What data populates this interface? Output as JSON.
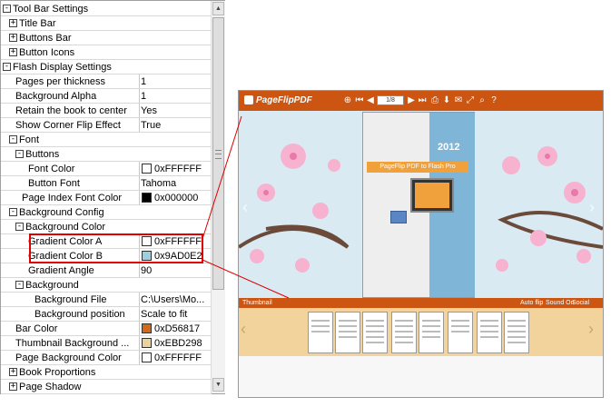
{
  "properties": [
    {
      "name": "Tool Bar Settings",
      "value": "",
      "indent": 0,
      "exp": "-",
      "cat": true
    },
    {
      "name": "Title Bar",
      "value": "",
      "indent": 1,
      "exp": "+",
      "cat": true
    },
    {
      "name": "Buttons Bar",
      "value": "",
      "indent": 1,
      "exp": "+",
      "cat": true
    },
    {
      "name": "Button Icons",
      "value": "",
      "indent": 1,
      "exp": "+",
      "cat": true
    },
    {
      "name": "Flash Display Settings",
      "value": "",
      "indent": 0,
      "exp": "-",
      "cat": true
    },
    {
      "name": "Pages per thickness",
      "value": "1",
      "indent": 2
    },
    {
      "name": "Background Alpha",
      "value": "1",
      "indent": 2
    },
    {
      "name": "Retain the book to center",
      "value": "Yes",
      "indent": 2
    },
    {
      "name": "Show Corner Flip Effect",
      "value": "True",
      "indent": 2
    },
    {
      "name": "Font",
      "value": "",
      "indent": 1,
      "exp": "-",
      "cat": true
    },
    {
      "name": "Buttons",
      "value": "",
      "indent": 2,
      "exp": "-",
      "cat": true
    },
    {
      "name": "Font Color",
      "value": "0xFFFFFF",
      "indent": 4,
      "swatch": "#ffffff"
    },
    {
      "name": "Button Font",
      "value": "Tahoma",
      "indent": 4
    },
    {
      "name": "Page Index Font Color",
      "value": "0x000000",
      "indent": 3,
      "swatch": "#000000"
    },
    {
      "name": "Background Config",
      "value": "",
      "indent": 1,
      "exp": "-",
      "cat": true
    },
    {
      "name": "Background Color",
      "value": "",
      "indent": 2,
      "exp": "-",
      "cat": true
    },
    {
      "name": "Gradient Color A",
      "value": "0xFFFFFF",
      "indent": 4,
      "swatch": "#ffffff"
    },
    {
      "name": "Gradient Color B",
      "value": "0x9AD0E2",
      "indent": 4,
      "swatch": "#9ad0e2"
    },
    {
      "name": "Gradient Angle",
      "value": "90",
      "indent": 4
    },
    {
      "name": "Background",
      "value": "",
      "indent": 2,
      "exp": "-",
      "cat": true
    },
    {
      "name": "Background File",
      "value": "C:\\Users\\Mo...",
      "indent": 5
    },
    {
      "name": "Background position",
      "value": "Scale to fit",
      "indent": 5
    },
    {
      "name": "Bar Color",
      "value": "0xD56817",
      "indent": 2,
      "swatch": "#d56817"
    },
    {
      "name": "Thumbnail Background ...",
      "value": "0xEBD298",
      "indent": 2,
      "swatch": "#ebd298"
    },
    {
      "name": "Page Background Color",
      "value": "0xFFFFFF",
      "indent": 2,
      "swatch": "#ffffff"
    },
    {
      "name": "Book Proportions",
      "value": "",
      "indent": 1,
      "exp": "+",
      "cat": true
    },
    {
      "name": "Page Shadow",
      "value": "",
      "indent": 1,
      "exp": "+",
      "cat": true
    }
  ],
  "preview": {
    "logo": "PageFlipPDF",
    "page_input": "1/8",
    "cover_year": "2012",
    "cover_band": "PageFlip PDF to Flash Pro",
    "thumbnail_label": "Thumbnail",
    "auto_flip": "Auto flip",
    "sound_on": "Sound On",
    "social_share": "Social Share"
  },
  "colors": {
    "bar": "#cc5512",
    "thumb_bg": "#f1d39b",
    "highlight": "#e00000"
  }
}
